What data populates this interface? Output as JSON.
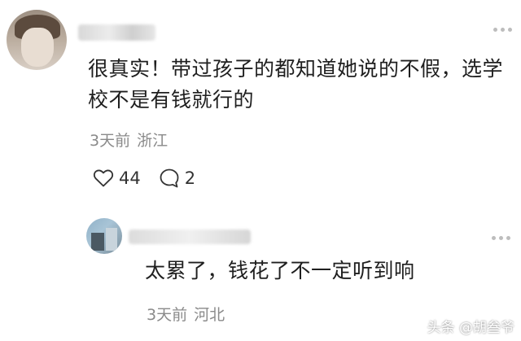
{
  "comment": {
    "text": "很真实！带过孩子的都知道她说的不假，选学校不是有钱就行的",
    "time": "3天前",
    "location": "浙江",
    "likes": "44",
    "replies": "2"
  },
  "reply": {
    "text": "太累了，钱花了不一定听到响",
    "time": "3天前",
    "location": "河北"
  },
  "watermark": "头条 @胡叁爷",
  "icons": {
    "like": "heart-icon",
    "reply": "comment-bubble-icon",
    "more": "more-dots-icon"
  }
}
